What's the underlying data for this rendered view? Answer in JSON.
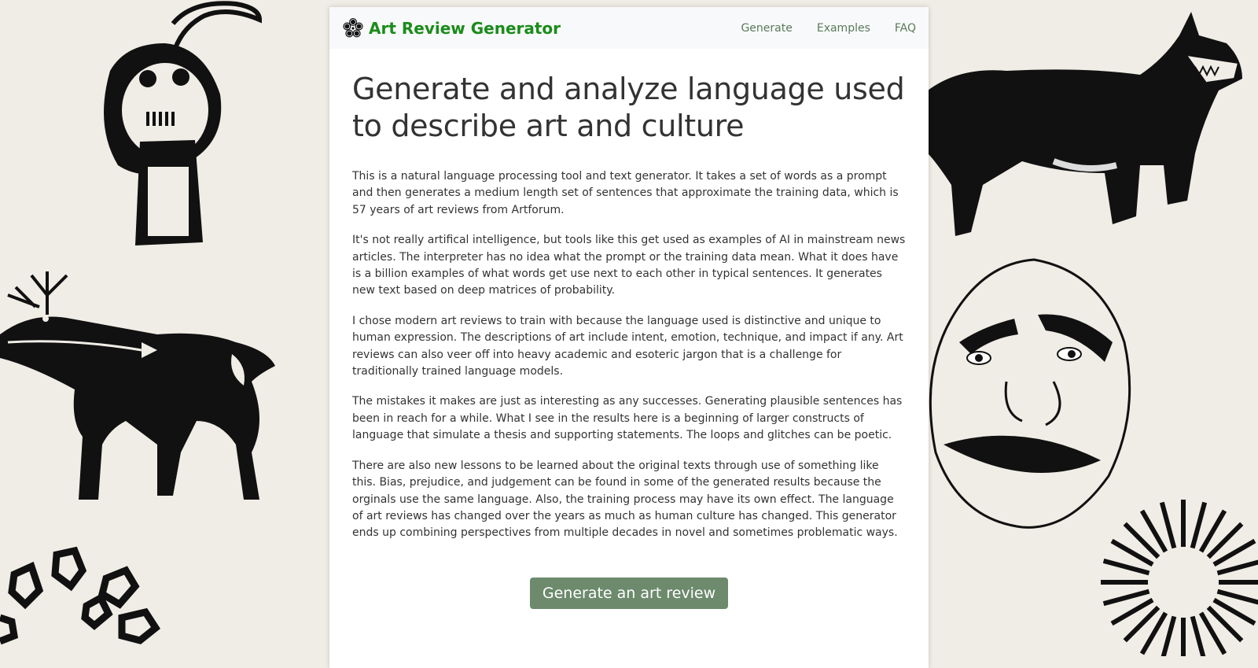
{
  "nav": {
    "brand_title": "Art Review Generator",
    "brand_icon": "flower-icon",
    "links": [
      "Generate",
      "Examples",
      "FAQ"
    ]
  },
  "main": {
    "heading": "Generate and analyze language used to describe art and culture",
    "paragraphs": [
      "This is a natural language processing tool and text generator. It takes a set of words as a prompt and then generates a medium length set of sentences that approximate the training data, which is 57 years of art reviews from Artforum.",
      "It's not really artifical intelligence, but tools like this get used as examples of AI in mainstream news articles. The interpreter has no idea what the prompt or the training data mean. What it does have is a billion examples of what words get use next to each other in typical sentences. It generates new text based on deep matrices of probability.",
      "I chose modern art reviews to train with because the language used is distinctive and unique to human expression. The descriptions of art include intent, emotion, technique, and impact if any. Art reviews can also veer off into heavy academic and esoteric jargon that is a challenge for traditionally trained language models.",
      "The mistakes it makes are just as interesting as any successes. Generating plausible sentences has been in reach for a while. What I see in the results here is a beginning of larger constructs of language that simulate a thesis and supporting statements. The loops and glitches can be poetic.",
      "There are also new lessons to be learned about the original texts through use of something like this. Bias, prejudice, and judgement can be found in some of the generated results because the orginals use the same language. Also, the training process may have its own effect. The language of art reviews has changed over the years as much as human culture has changed. This generator ends up combining perspectives from multiple decades in novel and sometimes problematic ways."
    ],
    "generate_button": "Generate an art review"
  },
  "colors": {
    "background": "#f0ede6",
    "brand": "#1a8c1a",
    "button": "#6d8a6d",
    "nav_link": "#5a7a5a"
  },
  "decorations": [
    "skull-figure-art",
    "deer-figure-art",
    "stone-shapes-art",
    "wolf-figure-art",
    "mask-face-art",
    "sunburst-art"
  ]
}
